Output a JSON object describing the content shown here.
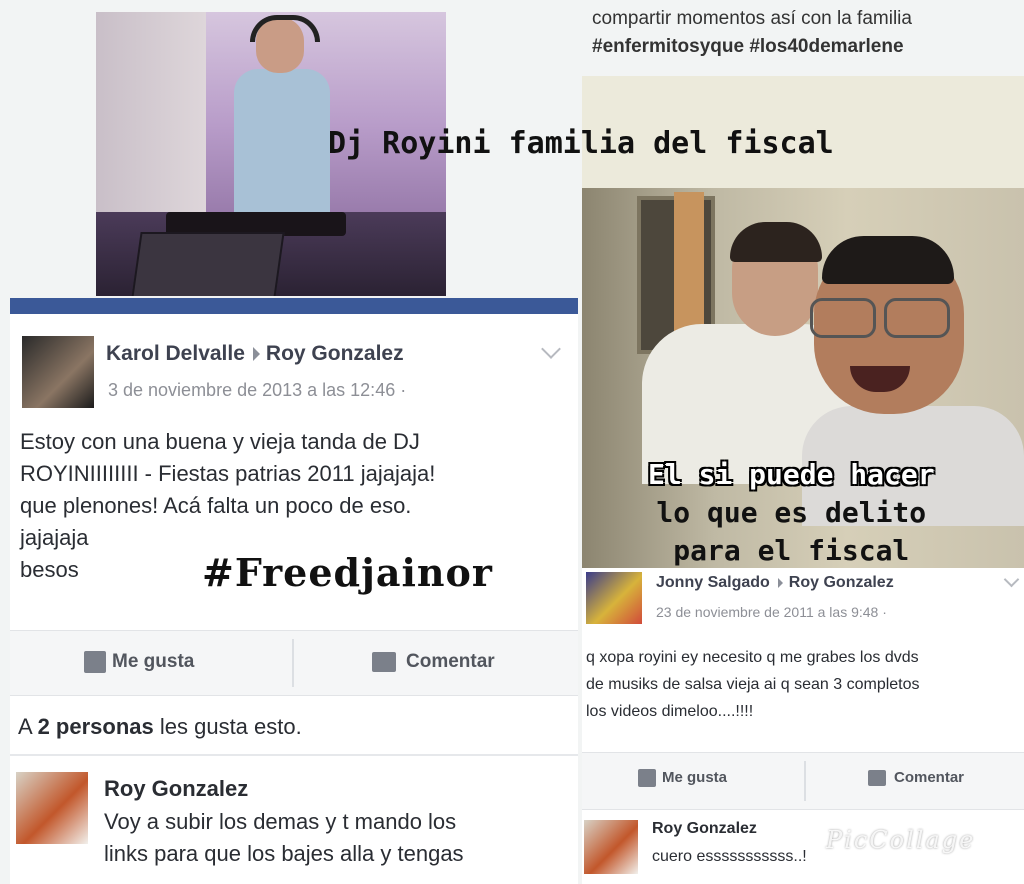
{
  "photo_overlay": {
    "title": "Dj Royini familia del fiscal",
    "caption_lines": [
      "El si puede hacer",
      "lo que es delito",
      "para el fiscal"
    ]
  },
  "left_post": {
    "author": "Karol Delvalle",
    "target": "Roy Gonzalez",
    "date": "3 de noviembre de 2013 a las 12:46 ·",
    "body_lines": [
      "Estoy con una buena y vieja tanda de DJ",
      "ROYINIIIIIIII - Fiestas patrias 2011 jajajaja!",
      "que plenones! Acá falta un poco de eso.",
      "jajajaja",
      "besos"
    ],
    "hashtag_overlay": "#Freedjainor",
    "like_label": "Me gusta",
    "comment_label": "Comentar",
    "likes_prefix": "A ",
    "likes_bold": "2 personas",
    "likes_suffix": " les gusta esto.",
    "comment": {
      "author": "Roy Gonzalez",
      "lines": [
        "Voy a subir los demas y t mando los",
        "links para que los bajes alla y tengas"
      ]
    }
  },
  "right_top": {
    "text": "compartir momentos así con la familia",
    "tags": "#enfermitosyque #los40demarlene"
  },
  "right_post": {
    "author": "Jonny Salgado",
    "target": "Roy Gonzalez",
    "date": "23 de noviembre de 2011 a las 9:48 ·",
    "body_lines": [
      "q xopa royini ey necesito q me grabes los dvds",
      "de musiks de salsa vieja ai q sean 3 completos",
      "los videos dimeloo....!!!!"
    ],
    "like_label": "Me gusta",
    "comment_label": "Comentar",
    "comment": {
      "author": "Roy Gonzalez",
      "text": "cuero esssssssssss..!"
    }
  },
  "watermark": "PicCollage"
}
